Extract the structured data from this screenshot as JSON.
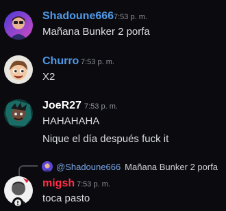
{
  "colors": {
    "background": "#0b0b0f",
    "shadoune_name": "#4f9ae8",
    "churro_name": "#4f9ae8",
    "joer27_name": "#ffffff",
    "migsh_name": "#ff3047",
    "timestamp": "#8e9099",
    "reply_user": "#7aa7e8"
  },
  "messages": [
    {
      "username": "Shadoune666",
      "timestamp": "7:53 p. m.",
      "text": "Mañana Bunker 2 porfa",
      "avatar_icon": "shadoune-avatar"
    },
    {
      "username": "Churro",
      "timestamp": "7:53 p. m.",
      "text": "X2",
      "avatar_icon": "churro-avatar"
    },
    {
      "username": "JoeR27",
      "timestamp": "7:53 p. m.",
      "lines": [
        "HAHAHAHA",
        "Nique el día después fuck it"
      ],
      "avatar_icon": "joer27-avatar"
    },
    {
      "username": "migsh",
      "timestamp": "7:53 p. m.",
      "text": "toca pasto",
      "avatar_icon": "migsh-avatar",
      "reply": {
        "user": "@Shadoune666",
        "text": "Mañana Bunker 2 porfa"
      }
    }
  ]
}
